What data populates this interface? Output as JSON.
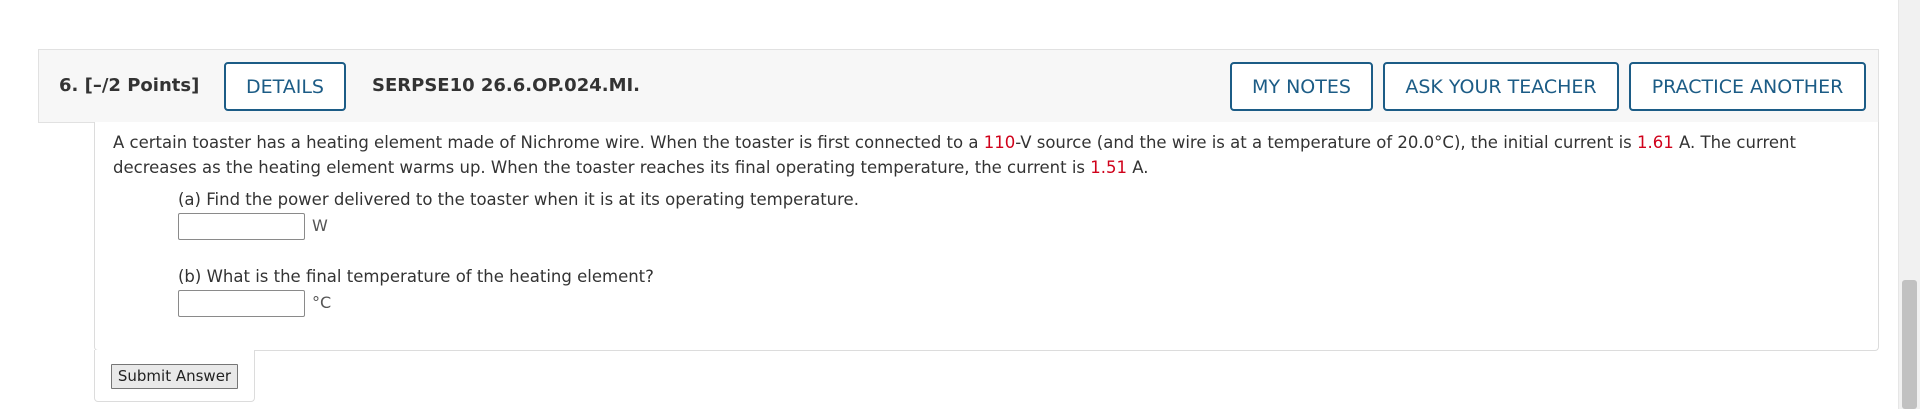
{
  "question": {
    "number_points": "6.  [–/2 Points]",
    "details_label": "DETAILS",
    "code": "SERPSE10 26.6.OP.024.MI.",
    "my_notes_label": "MY NOTES",
    "ask_teacher_label": "ASK YOUR TEACHER",
    "practice_label": "PRACTICE ANOTHER"
  },
  "prompt": {
    "t1": "A certain toaster has a heating element made of Nichrome wire. When the toaster is first connected to a ",
    "voltage": "110",
    "t2": "-V source (and the wire is at a temperature of 20.0°C), the initial current is ",
    "initial_current": "1.61",
    "t3": " A. The current decreases as the heating element warms up. When the toaster reaches its final operating temperature, the current is ",
    "final_current": "1.51",
    "t4": " A."
  },
  "parts": [
    {
      "label": "(a) Find the power delivered to the toaster when it is at its operating temperature.",
      "value": "",
      "unit": "W"
    },
    {
      "label": "(b) What is the final temperature of the heating element?",
      "value": "",
      "unit": "°C"
    }
  ],
  "submit_label": "Submit Answer",
  "colors": {
    "accent": "#1c5c86",
    "given_value_red": "#d0021b",
    "header_bg": "#f7f7f7"
  }
}
